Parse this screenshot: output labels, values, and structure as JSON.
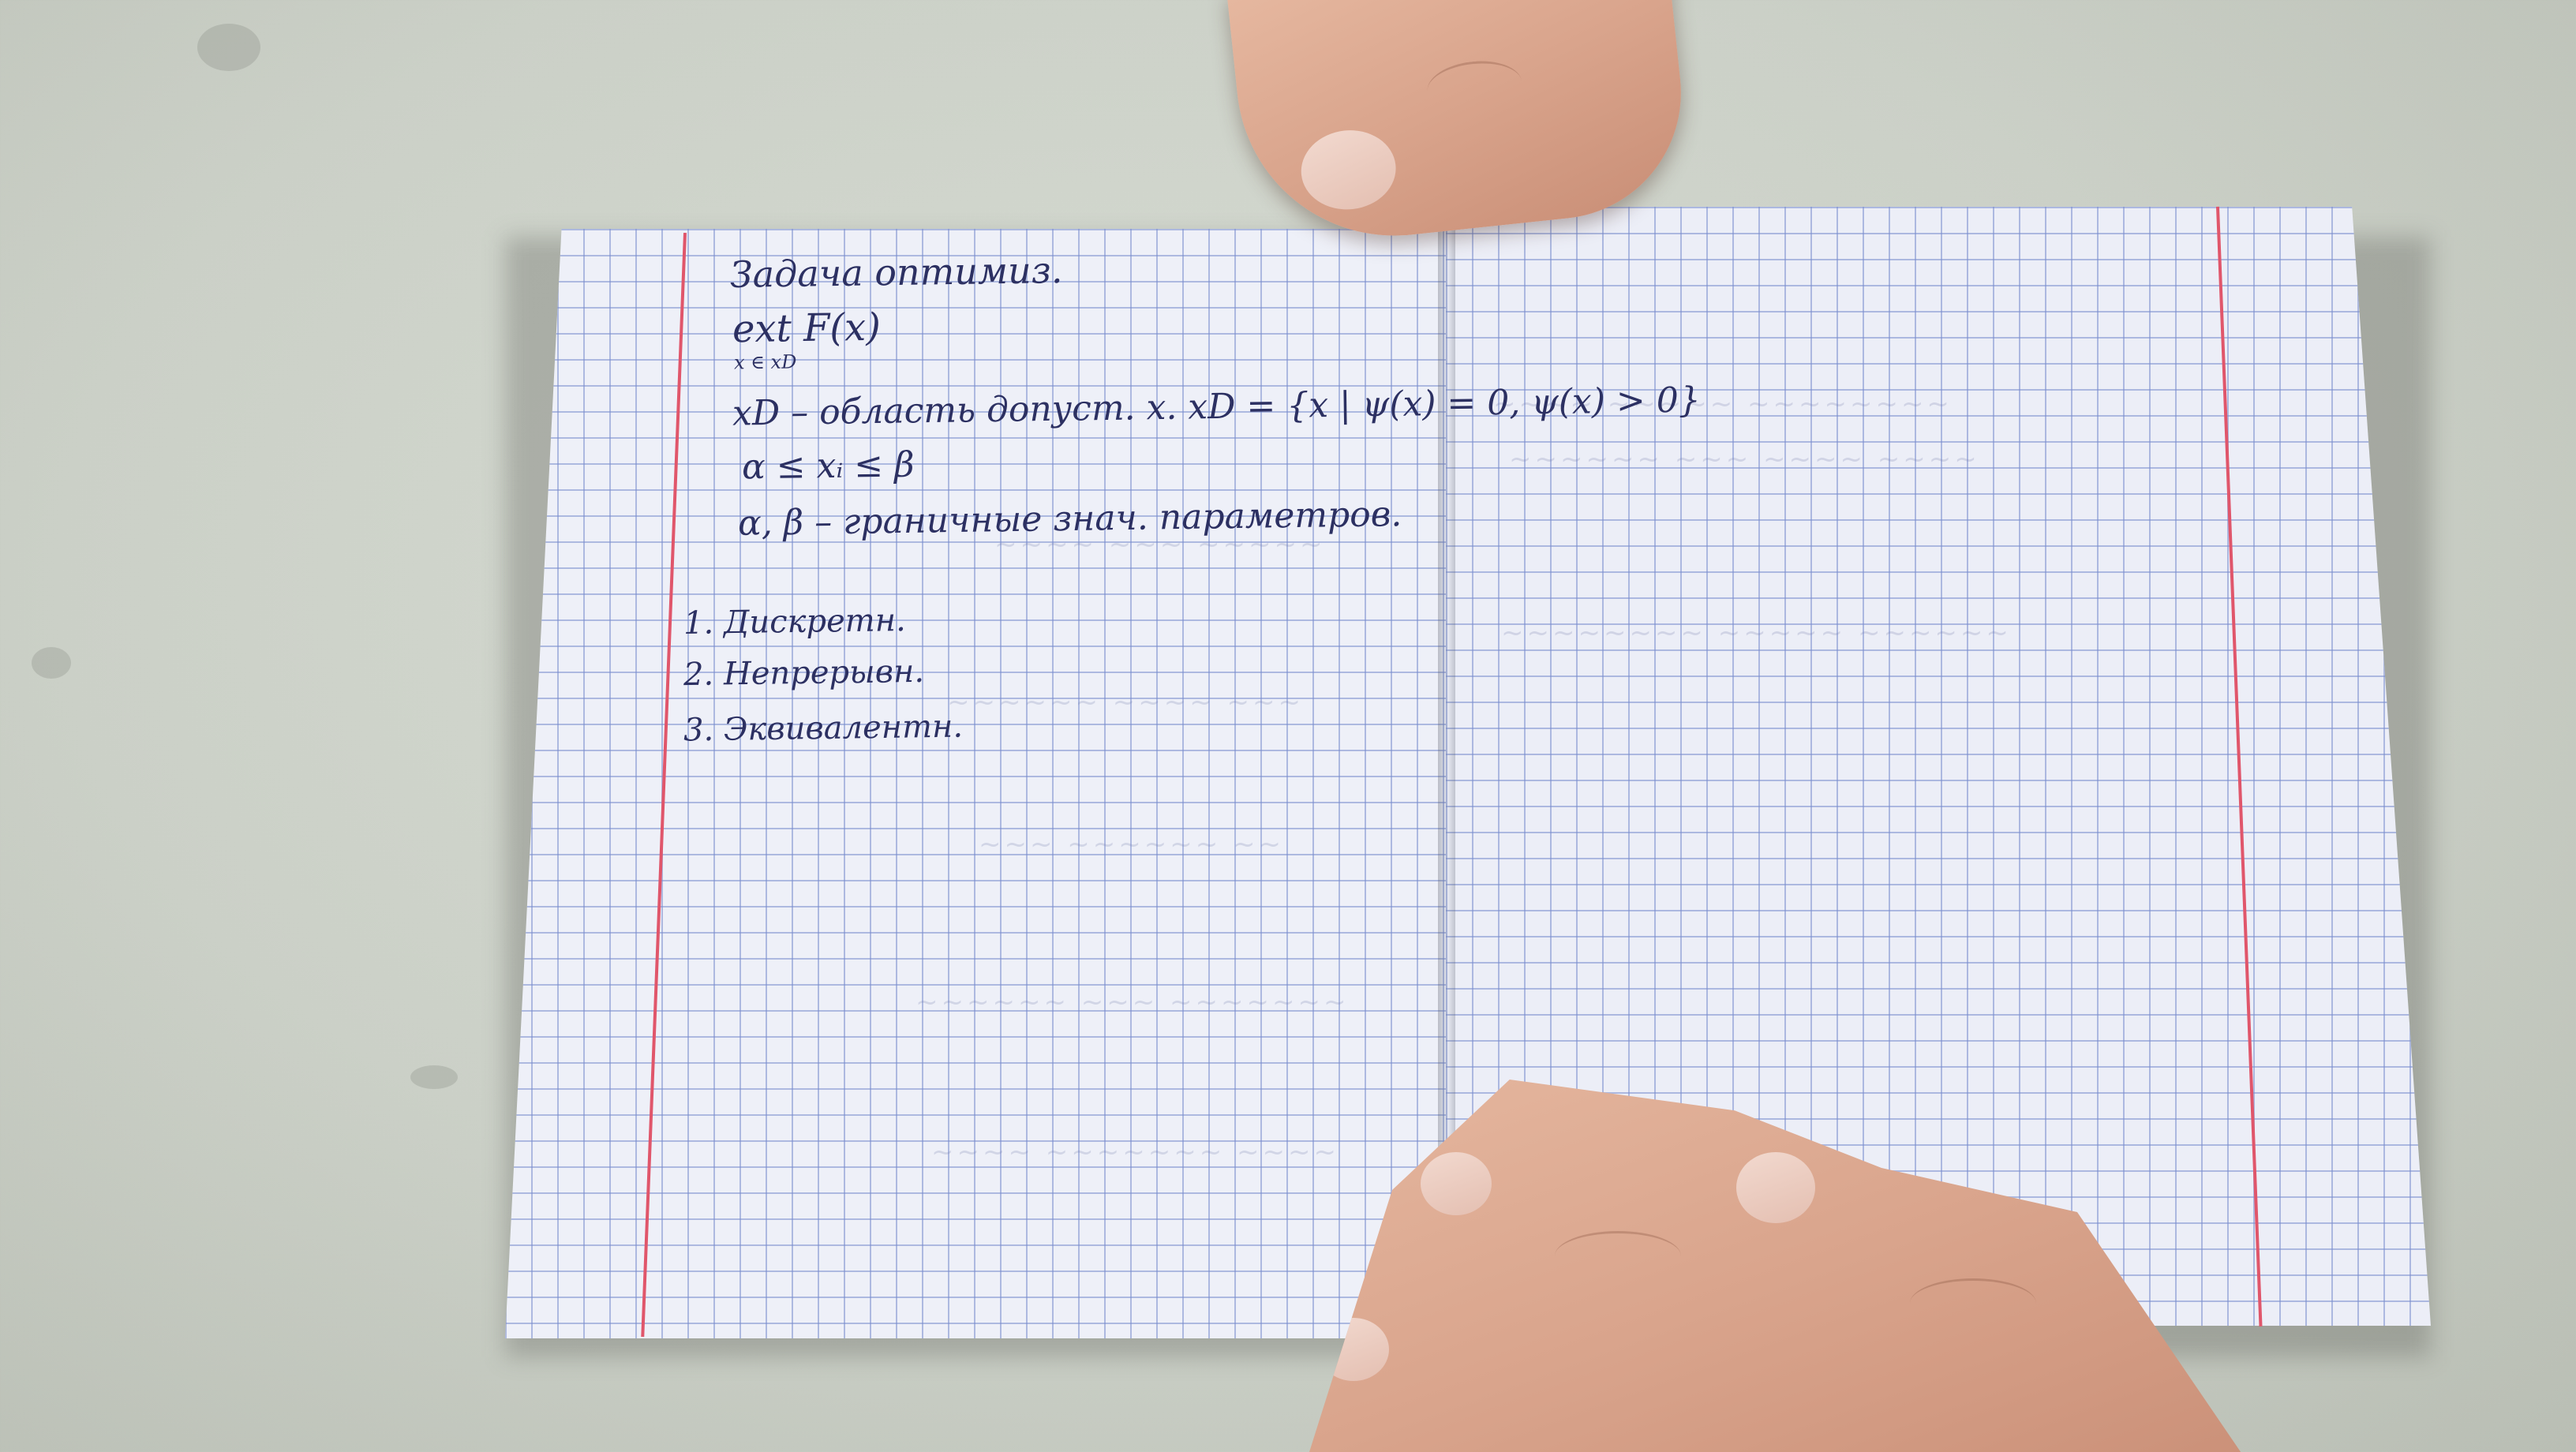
{
  "image": {
    "description_colors": {
      "desk": "#cbd0c7",
      "paper": "#eef0f8",
      "grid": "#7c8ccd",
      "margin_line": "#e0566b",
      "ink": "#2c3062",
      "skin": "#d9a48c"
    }
  },
  "notebook": {
    "left_page": {
      "lines": [
        "Задача оптимиз.",
        "ext F(x)",
        "x ∈ xD",
        "xD – область допуст. x.   xD = {x | ψ(x) = 0, ψ(x) > 0}",
        "α ≤ xᵢ ≤ β",
        "α, β – граничные знач. параметров."
      ],
      "list": [
        "1. Дискретн.",
        "2. Непрерывн.",
        "3. Эквивалентн."
      ]
    },
    "right_page": {
      "lines": []
    }
  }
}
